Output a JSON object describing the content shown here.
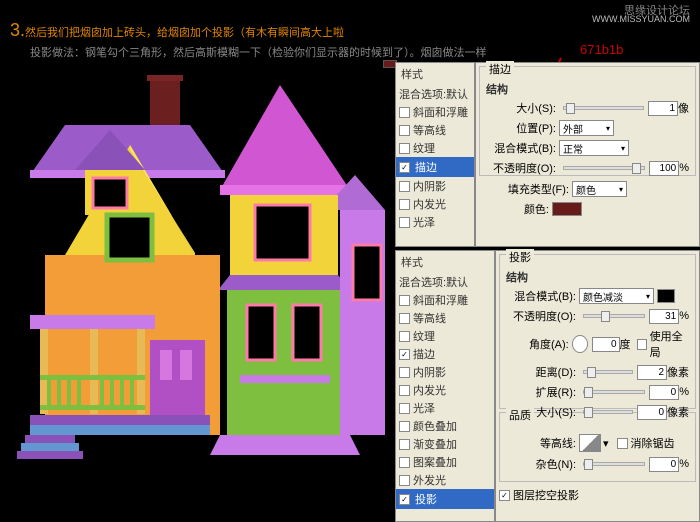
{
  "header": {
    "forum": "思缘设计论坛",
    "watermark": "WWW.MISSYUAN.COM"
  },
  "step": {
    "num": "3.",
    "title": "然后我们把烟囱加上砖头，给烟囱加个投影（有木有瞬间高大上啦"
  },
  "subnote": "投影做法：钢笔勾个三角形，然后高斯模糊一下（检验你们显示器的时候到了）。烟囱做法一样",
  "color_code": "671b1b",
  "panel1": {
    "title": "样式",
    "subtitle": "混合选项:默认",
    "items": [
      "斜面和浮雕",
      "等高线",
      "纹理",
      "描边",
      "内阴影",
      "内发光",
      "光泽"
    ],
    "checked": [
      false,
      false,
      false,
      true,
      false,
      false,
      false
    ],
    "selected_index": 3
  },
  "stroke": {
    "group": "描边",
    "struct": "结构",
    "size_l": "大小(S):",
    "size_v": "1",
    "size_u": "像",
    "pos_l": "位置(P):",
    "pos_v": "外部",
    "blend_l": "混合模式(B):",
    "blend_v": "正常",
    "opac_l": "不透明度(O):",
    "opac_v": "100",
    "opac_u": "%",
    "filltype_l": "填充类型(F):",
    "filltype_v": "颜色",
    "color_l": "颜色:"
  },
  "panel2": {
    "title": "样式",
    "subtitle": "混合选项:默认",
    "items": [
      "斜面和浮雕",
      "等高线",
      "纹理",
      "描边",
      "内阴影",
      "内发光",
      "光泽",
      "颜色叠加",
      "渐变叠加",
      "图案叠加",
      "外发光",
      "投影"
    ],
    "checked": [
      false,
      false,
      false,
      true,
      false,
      false,
      false,
      false,
      false,
      false,
      false,
      true
    ],
    "selected_index": 11
  },
  "shadow": {
    "group": "投影",
    "struct": "结构",
    "blend_l": "混合模式(B):",
    "blend_v": "颜色减淡",
    "opac_l": "不透明度(O):",
    "opac_v": "31",
    "opac_u": "%",
    "angle_l": "角度(A):",
    "angle_v": "0",
    "angle_u": "度",
    "global": "使用全局",
    "dist_l": "距离(D):",
    "dist_v": "2",
    "dist_u": "像素",
    "spread_l": "扩展(R):",
    "spread_v": "0",
    "spread_u": "%",
    "size_l": "大小(S):",
    "size_v": "0",
    "size_u": "像素",
    "quality": "品质",
    "contour_l": "等高线:",
    "anti": "消除锯齿",
    "noise_l": "杂色(N):",
    "noise_v": "0",
    "noise_u": "%",
    "knockout": "图层挖空投影"
  }
}
